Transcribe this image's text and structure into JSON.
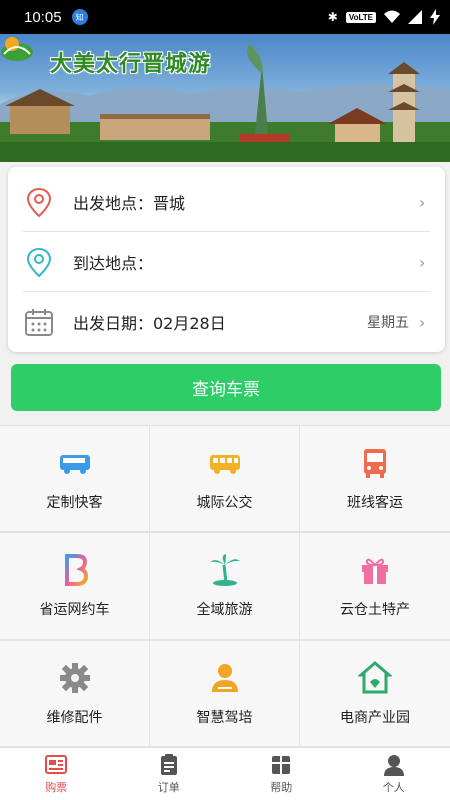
{
  "status_bar": {
    "time": "10:05",
    "notification": "知",
    "network": "VoLTE"
  },
  "banner": {
    "title": "大美太行晋城游"
  },
  "form": {
    "departure": {
      "label": "出发地点：晋城",
      "icon": "location-pin-icon"
    },
    "arrival": {
      "label": "到达地点：",
      "icon": "location-pin-icon"
    },
    "date": {
      "label": "出发日期：02月28日",
      "weekday": "星期五",
      "icon": "calendar-icon"
    }
  },
  "query_button": {
    "label": "查询车票"
  },
  "services": [
    {
      "label": "定制快客",
      "icon": "bus-icon",
      "color": "#3b9be6"
    },
    {
      "label": "城际公交",
      "icon": "bus-icon",
      "color": "#f2b224"
    },
    {
      "label": "班线客运",
      "icon": "coach-icon",
      "color": "#ef6b4d"
    },
    {
      "label": "省运网约车",
      "icon": "ride-hailing-icon",
      "color": "#e65fa0"
    },
    {
      "label": "全域旅游",
      "icon": "palm-tree-icon",
      "color": "#2fb38f"
    },
    {
      "label": "云仓土特产",
      "icon": "gift-icon",
      "color": "#f06fa0"
    },
    {
      "label": "维修配件",
      "icon": "gear-icon",
      "color": "#8a8a8a"
    },
    {
      "label": "智慧驾培",
      "icon": "driver-icon",
      "color": "#f2a424"
    },
    {
      "label": "电商产业园",
      "icon": "shop-icon",
      "color": "#2faa6a"
    }
  ],
  "tabbar": [
    {
      "label": "购票",
      "icon": "ticket-icon",
      "active": true
    },
    {
      "label": "订单",
      "icon": "clipboard-icon",
      "active": false
    },
    {
      "label": "帮助",
      "icon": "gift-box-icon",
      "active": false
    },
    {
      "label": "个人",
      "icon": "person-icon",
      "active": false
    }
  ],
  "colors": {
    "accent_green": "#2fcd68",
    "active_tab": "#e94a4a"
  }
}
